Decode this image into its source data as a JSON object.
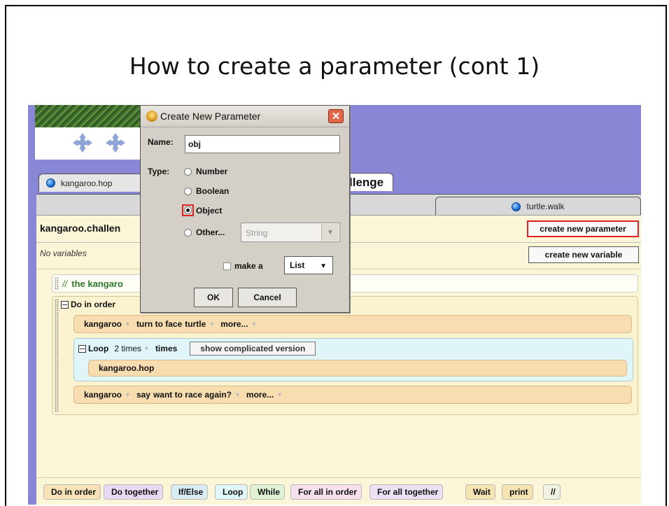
{
  "slide": {
    "title": "How to create a parameter (cont 1)"
  },
  "tabs": [
    {
      "label": "kangaroo.hop",
      "icon": "method-dot-icon"
    },
    {
      "label": "llenge"
    },
    {
      "label": "turtle.walk",
      "icon": "method-dot-icon"
    }
  ],
  "method": {
    "name": "kangaroo.challen",
    "create_param_label": "create new parameter",
    "no_vars_label": "No variables",
    "create_var_label": "create new variable"
  },
  "code": {
    "comment_slashes": "//",
    "comment_text": "the kangaro",
    "doinorder_label": "Do in order",
    "stmt1": {
      "obj": "kangaroo",
      "verb": "turn to face",
      "arg": "turtle",
      "more": "more..."
    },
    "loop": {
      "label": "Loop",
      "count": "2 times",
      "times": "times",
      "complicated": "show complicated version",
      "body": "kangaroo.hop"
    },
    "stmt2": {
      "obj": "kangaroo",
      "verb": "say",
      "arg": "want to race again?",
      "more": "more..."
    }
  },
  "controls": [
    {
      "label": "Do in order",
      "color": "#f7e2b8"
    },
    {
      "label": "Do together",
      "color": "#e9d9f2"
    },
    {
      "label": "If/Else",
      "color": "#d9ecf2"
    },
    {
      "label": "Loop",
      "color": "#dff5f7"
    },
    {
      "label": "While",
      "color": "#dff3d4"
    },
    {
      "label": "For all in order",
      "color": "#f6e0ee"
    },
    {
      "label": "For all together",
      "color": "#ece0f4"
    },
    {
      "label": "Wait",
      "color": "#f6e3b2"
    },
    {
      "label": "print",
      "color": "#f6e3b2"
    },
    {
      "label": "//",
      "color": "#f2f2e0"
    }
  ],
  "dialog": {
    "title": "Create New Parameter",
    "name_label": "Name:",
    "name_value": "obj",
    "type_label": "Type:",
    "types": [
      "Number",
      "Boolean",
      "Object",
      "Other..."
    ],
    "selected_type": "Object",
    "other_value": "String",
    "make_a_label": "make a",
    "list_value": "List",
    "ok_label": "OK",
    "cancel_label": "Cancel"
  }
}
